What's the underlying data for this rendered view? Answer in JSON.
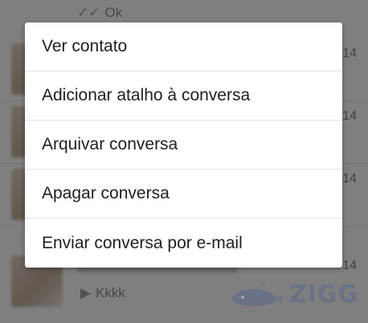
{
  "background": {
    "top_preview": "Ok",
    "bottom_preview": "Kkkk",
    "times": [
      "14",
      "14",
      "14",
      "14",
      "14"
    ]
  },
  "menu": {
    "items": [
      {
        "label": "Ver contato"
      },
      {
        "label": "Adicionar atalho à conversa"
      },
      {
        "label": "Arquivar conversa"
      },
      {
        "label": "Apagar conversa"
      },
      {
        "label": "Enviar conversa por e-mail"
      }
    ]
  },
  "watermark": {
    "brand": "ZIGG"
  }
}
